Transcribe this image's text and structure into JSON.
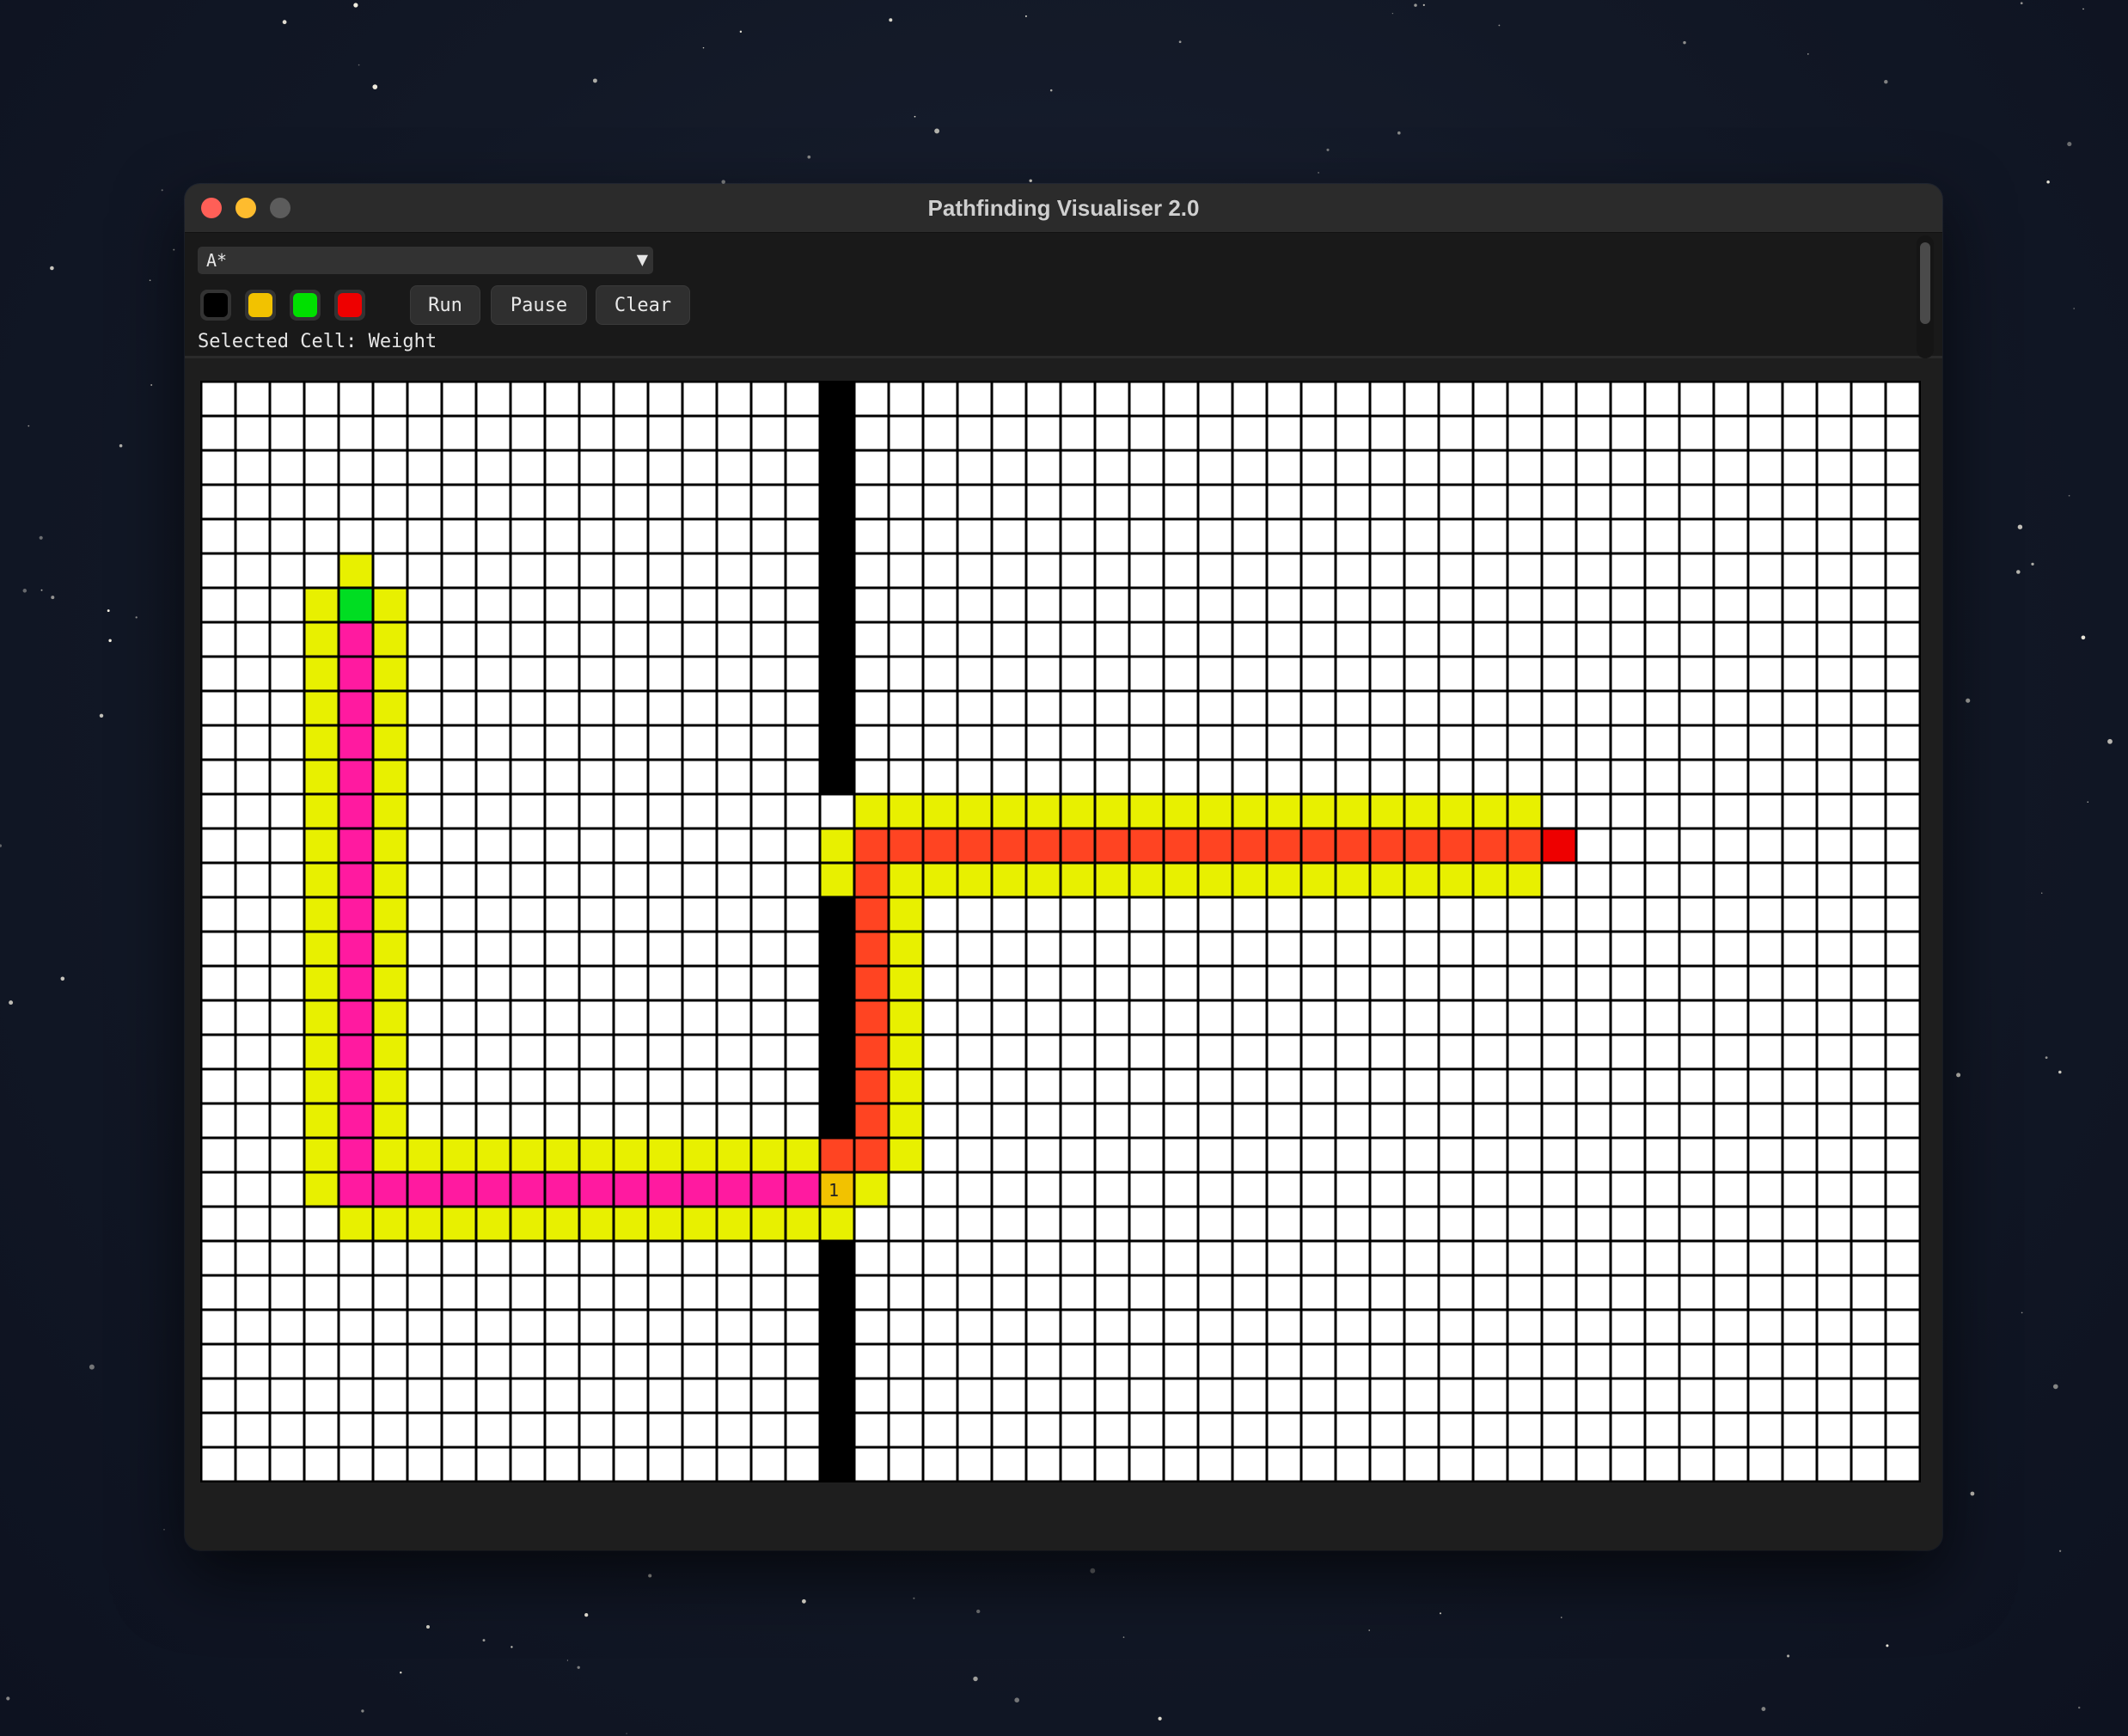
{
  "window": {
    "title": "Pathfinding Visualiser 2.0",
    "traffic_lights": {
      "close": "#ff5f57",
      "minimize": "#febc2e",
      "zoom": "#5c5c5c"
    }
  },
  "toolbar": {
    "algorithm": {
      "selected": "A*",
      "icon": "triangle-down-icon"
    },
    "palette": [
      {
        "name": "wall",
        "color": "#000000"
      },
      {
        "name": "weight",
        "color": "#f2c200"
      },
      {
        "name": "start",
        "color": "#00e000"
      },
      {
        "name": "end",
        "color": "#ee0000"
      }
    ],
    "run_label": "Run",
    "pause_label": "Pause",
    "clear_label": "Clear",
    "status": "Selected Cell: Weight"
  },
  "grid": {
    "cols": 50,
    "rows": 32,
    "colors": {
      "empty": "#ffffff",
      "wall": "#000000",
      "visited": "#e8f000",
      "path_1": "#ff1aa0",
      "path_2": "#ff4422",
      "start": "#00dd22",
      "end": "#ee0000",
      "weight": "#f2c200"
    },
    "start": {
      "col": 4,
      "row": 6
    },
    "end": {
      "col": 39,
      "row": 13
    },
    "weight_cell": {
      "col": 18,
      "row": 23,
      "label": "1"
    },
    "walls": [
      {
        "col": 18,
        "rows_from": 0,
        "rows_to": 11
      },
      {
        "col": 18,
        "rows_from": 15,
        "rows_to": 21
      },
      {
        "col": 18,
        "rows_from": 25,
        "rows_to": 31
      }
    ],
    "visited_rects": [
      {
        "c0": 4,
        "c1": 4,
        "r0": 5,
        "r1": 5
      },
      {
        "c0": 3,
        "c1": 5,
        "r0": 6,
        "r1": 23
      },
      {
        "c0": 4,
        "c1": 17,
        "r0": 22,
        "r1": 24
      },
      {
        "c0": 18,
        "c1": 18,
        "r0": 24,
        "r1": 24
      },
      {
        "c0": 19,
        "c1": 19,
        "r0": 23,
        "r1": 23
      },
      {
        "c0": 19,
        "c1": 20,
        "r0": 14,
        "r1": 22
      },
      {
        "c0": 18,
        "c1": 18,
        "r0": 13,
        "r1": 14
      },
      {
        "c0": 19,
        "c1": 38,
        "r0": 12,
        "r1": 14
      }
    ],
    "path_1_rects": [
      {
        "c0": 4,
        "c1": 4,
        "r0": 7,
        "r1": 23
      },
      {
        "c0": 5,
        "c1": 17,
        "r0": 23,
        "r1": 23
      }
    ],
    "path_2_rects": [
      {
        "c0": 18,
        "c1": 19,
        "r0": 22,
        "r1": 22
      },
      {
        "c0": 19,
        "c1": 19,
        "r0": 13,
        "r1": 21
      },
      {
        "c0": 20,
        "c1": 38,
        "r0": 13,
        "r1": 13
      }
    ]
  }
}
